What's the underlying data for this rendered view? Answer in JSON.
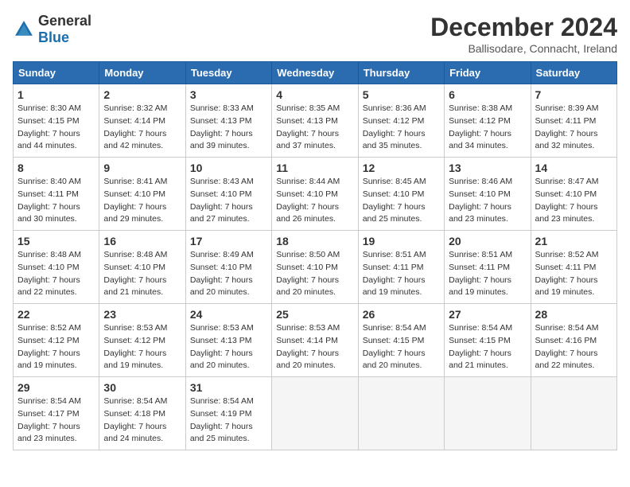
{
  "logo": {
    "general": "General",
    "blue": "Blue"
  },
  "title": "December 2024",
  "subtitle": "Ballisodare, Connacht, Ireland",
  "headers": [
    "Sunday",
    "Monday",
    "Tuesday",
    "Wednesday",
    "Thursday",
    "Friday",
    "Saturday"
  ],
  "weeks": [
    [
      {
        "day": "1",
        "sunrise": "8:30 AM",
        "sunset": "4:15 PM",
        "daylight": "7 hours and 44 minutes."
      },
      {
        "day": "2",
        "sunrise": "8:32 AM",
        "sunset": "4:14 PM",
        "daylight": "7 hours and 42 minutes."
      },
      {
        "day": "3",
        "sunrise": "8:33 AM",
        "sunset": "4:13 PM",
        "daylight": "7 hours and 39 minutes."
      },
      {
        "day": "4",
        "sunrise": "8:35 AM",
        "sunset": "4:13 PM",
        "daylight": "7 hours and 37 minutes."
      },
      {
        "day": "5",
        "sunrise": "8:36 AM",
        "sunset": "4:12 PM",
        "daylight": "7 hours and 35 minutes."
      },
      {
        "day": "6",
        "sunrise": "8:38 AM",
        "sunset": "4:12 PM",
        "daylight": "7 hours and 34 minutes."
      },
      {
        "day": "7",
        "sunrise": "8:39 AM",
        "sunset": "4:11 PM",
        "daylight": "7 hours and 32 minutes."
      }
    ],
    [
      {
        "day": "8",
        "sunrise": "8:40 AM",
        "sunset": "4:11 PM",
        "daylight": "7 hours and 30 minutes."
      },
      {
        "day": "9",
        "sunrise": "8:41 AM",
        "sunset": "4:10 PM",
        "daylight": "7 hours and 29 minutes."
      },
      {
        "day": "10",
        "sunrise": "8:43 AM",
        "sunset": "4:10 PM",
        "daylight": "7 hours and 27 minutes."
      },
      {
        "day": "11",
        "sunrise": "8:44 AM",
        "sunset": "4:10 PM",
        "daylight": "7 hours and 26 minutes."
      },
      {
        "day": "12",
        "sunrise": "8:45 AM",
        "sunset": "4:10 PM",
        "daylight": "7 hours and 25 minutes."
      },
      {
        "day": "13",
        "sunrise": "8:46 AM",
        "sunset": "4:10 PM",
        "daylight": "7 hours and 23 minutes."
      },
      {
        "day": "14",
        "sunrise": "8:47 AM",
        "sunset": "4:10 PM",
        "daylight": "7 hours and 23 minutes."
      }
    ],
    [
      {
        "day": "15",
        "sunrise": "8:48 AM",
        "sunset": "4:10 PM",
        "daylight": "7 hours and 22 minutes."
      },
      {
        "day": "16",
        "sunrise": "8:48 AM",
        "sunset": "4:10 PM",
        "daylight": "7 hours and 21 minutes."
      },
      {
        "day": "17",
        "sunrise": "8:49 AM",
        "sunset": "4:10 PM",
        "daylight": "7 hours and 20 minutes."
      },
      {
        "day": "18",
        "sunrise": "8:50 AM",
        "sunset": "4:10 PM",
        "daylight": "7 hours and 20 minutes."
      },
      {
        "day": "19",
        "sunrise": "8:51 AM",
        "sunset": "4:11 PM",
        "daylight": "7 hours and 19 minutes."
      },
      {
        "day": "20",
        "sunrise": "8:51 AM",
        "sunset": "4:11 PM",
        "daylight": "7 hours and 19 minutes."
      },
      {
        "day": "21",
        "sunrise": "8:52 AM",
        "sunset": "4:11 PM",
        "daylight": "7 hours and 19 minutes."
      }
    ],
    [
      {
        "day": "22",
        "sunrise": "8:52 AM",
        "sunset": "4:12 PM",
        "daylight": "7 hours and 19 minutes."
      },
      {
        "day": "23",
        "sunrise": "8:53 AM",
        "sunset": "4:12 PM",
        "daylight": "7 hours and 19 minutes."
      },
      {
        "day": "24",
        "sunrise": "8:53 AM",
        "sunset": "4:13 PM",
        "daylight": "7 hours and 20 minutes."
      },
      {
        "day": "25",
        "sunrise": "8:53 AM",
        "sunset": "4:14 PM",
        "daylight": "7 hours and 20 minutes."
      },
      {
        "day": "26",
        "sunrise": "8:54 AM",
        "sunset": "4:15 PM",
        "daylight": "7 hours and 20 minutes."
      },
      {
        "day": "27",
        "sunrise": "8:54 AM",
        "sunset": "4:15 PM",
        "daylight": "7 hours and 21 minutes."
      },
      {
        "day": "28",
        "sunrise": "8:54 AM",
        "sunset": "4:16 PM",
        "daylight": "7 hours and 22 minutes."
      }
    ],
    [
      {
        "day": "29",
        "sunrise": "8:54 AM",
        "sunset": "4:17 PM",
        "daylight": "7 hours and 23 minutes."
      },
      {
        "day": "30",
        "sunrise": "8:54 AM",
        "sunset": "4:18 PM",
        "daylight": "7 hours and 24 minutes."
      },
      {
        "day": "31",
        "sunrise": "8:54 AM",
        "sunset": "4:19 PM",
        "daylight": "7 hours and 25 minutes."
      },
      null,
      null,
      null,
      null
    ]
  ]
}
